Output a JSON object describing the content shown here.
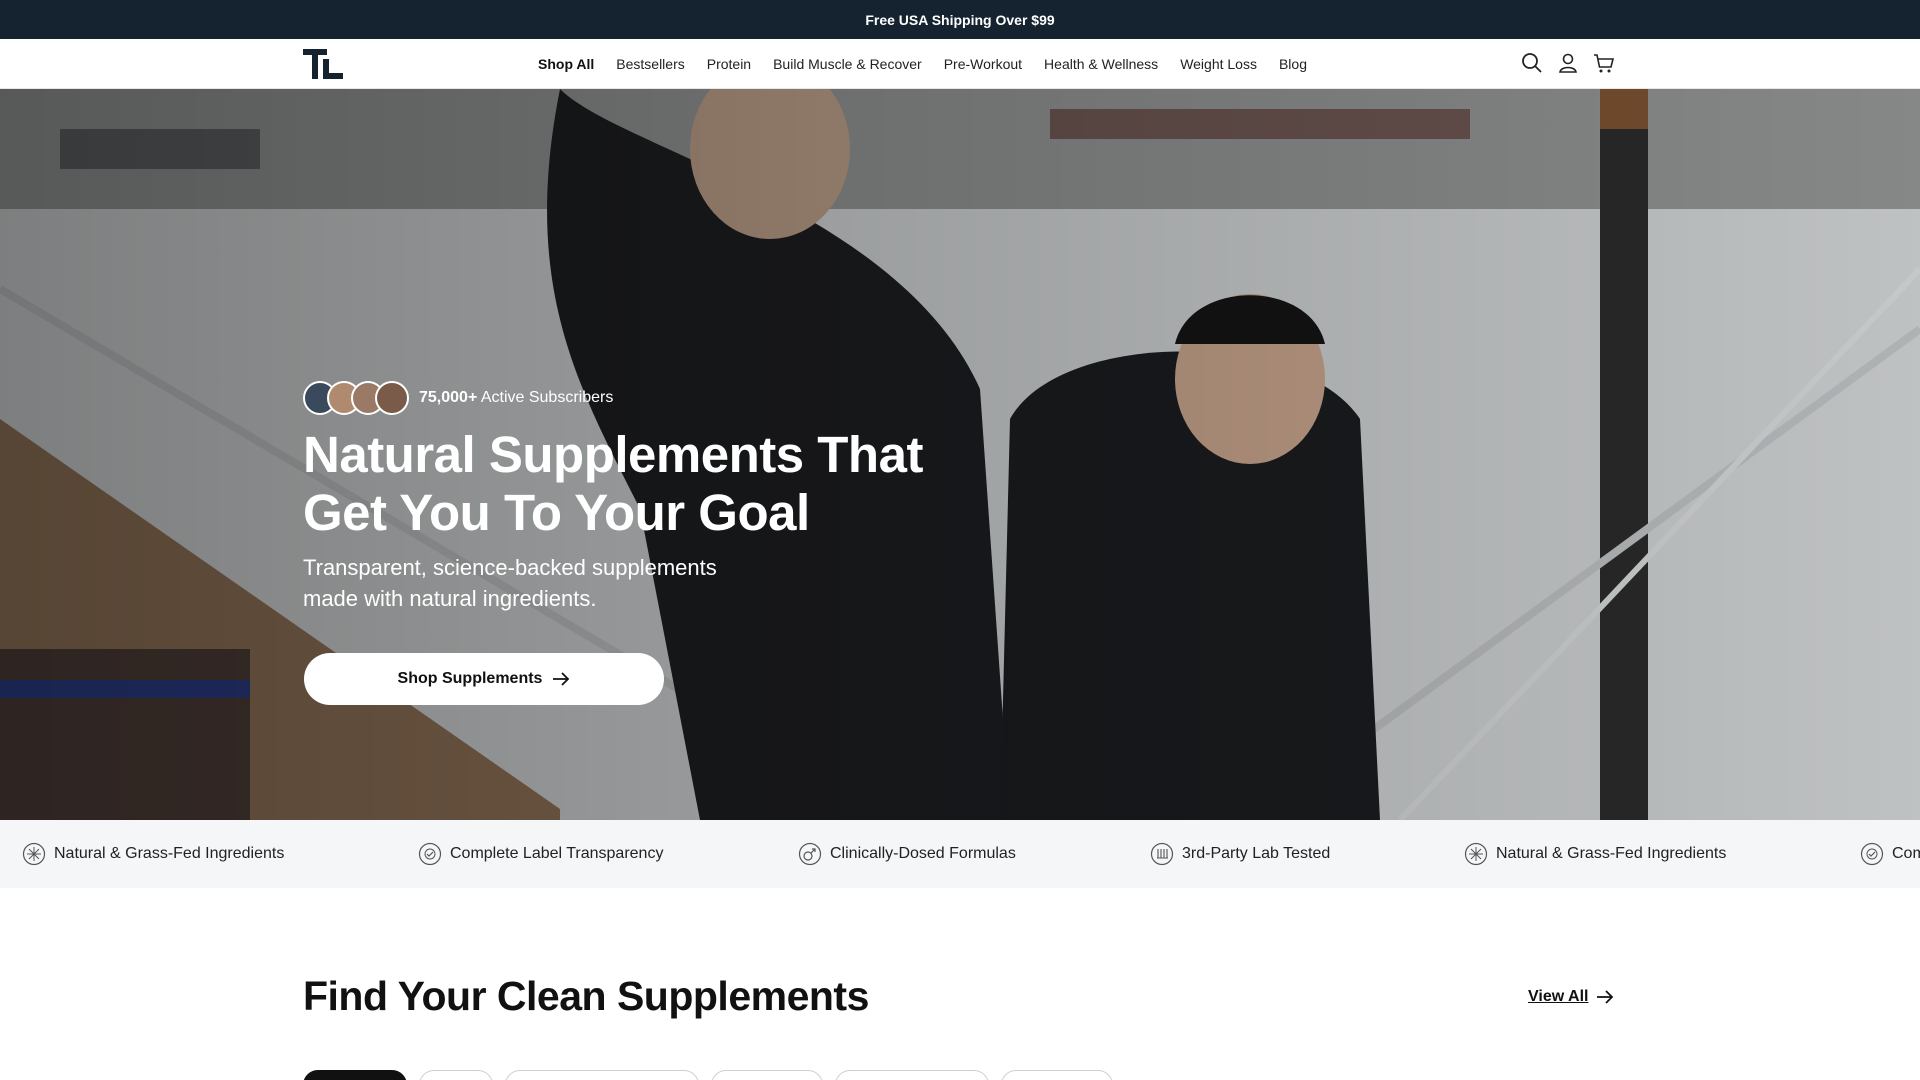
{
  "announcement": "Free USA Shipping Over $99",
  "header": {
    "logo_text": "TL",
    "nav": [
      "Shop All",
      "Bestsellers",
      "Protein",
      "Build Muscle & Recover",
      "Pre-Workout",
      "Health & Wellness",
      "Weight Loss",
      "Blog"
    ],
    "icons": [
      "search-icon",
      "account-icon",
      "cart-icon"
    ]
  },
  "hero": {
    "subscribers_count": "75,000+",
    "subscribers_label": "Active Subscribers",
    "title": "Natural Supplements That Get You To Your Goal",
    "subtitle": "Transparent, science-backed supplements made with natural ingredients.",
    "cta": "Shop Supplements"
  },
  "strip": [
    {
      "label": "Natural & Grass-Fed Ingredients",
      "icon": "leaf-badge-icon"
    },
    {
      "label": "Complete Label Transparency",
      "icon": "label-badge-icon"
    },
    {
      "label": "Clinically-Dosed Formulas",
      "icon": "formula-badge-icon"
    },
    {
      "label": "3rd-Party Lab Tested",
      "icon": "lab-badge-icon"
    },
    {
      "label": "Natural & Grass-Fed Ingredients",
      "icon": "leaf-badge-icon"
    },
    {
      "label": "Complete Label Transparency",
      "icon": "label-badge-icon"
    }
  ],
  "section": {
    "title": "Find Your Clean Supplements",
    "view_all": "View All"
  },
  "colors": {
    "announcement_bg": "#14232f",
    "text_dark": "#111111",
    "strip_bg": "#f5f6f7"
  }
}
